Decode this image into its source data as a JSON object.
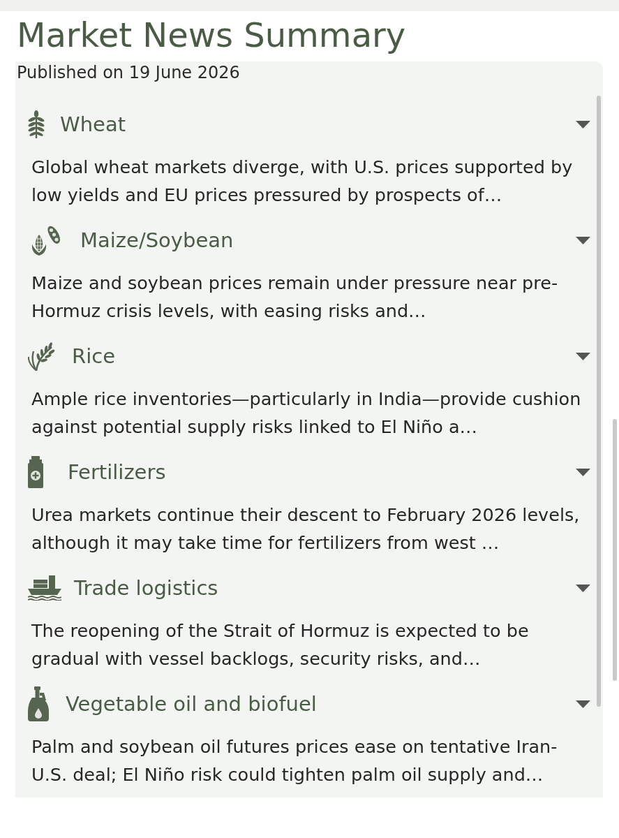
{
  "title": "Market News Summary",
  "published": "Published on 19 June 2026",
  "sections": [
    {
      "kind": "wheat",
      "title": "Wheat",
      "summary": "Global wheat markets diverge, with U.S. prices supported by low yields and EU prices pressured by prospects of…",
      "expanded": false
    },
    {
      "kind": "maize_soybean",
      "title": "Maize/Soybean",
      "summary": "Maize and soybean prices remain under pressure near pre-Hormuz crisis levels, with easing risks and…",
      "expanded": false
    },
    {
      "kind": "rice",
      "title": "Rice",
      "summary": "Ample rice inventories—particularly in India—provide cushion against potential supply risks linked to El Niño a…",
      "expanded": false
    },
    {
      "kind": "fertilizer",
      "title": "Fertilizers",
      "summary": "Urea markets continue their descent to February 2026 levels, although it may take time for fertilizers from west …",
      "expanded": false
    },
    {
      "kind": "logistics",
      "title": "Trade logistics",
      "summary": "The reopening of the Strait of Hormuz is expected to be gradual with vessel backlogs, security risks, and…",
      "expanded": false
    },
    {
      "kind": "veg_oil",
      "title": "Vegetable oil and biofuel",
      "summary": "Palm and soybean oil futures prices ease on tentative Iran-U.S. deal; El Niño risk could tighten palm oil supply and…",
      "expanded": false
    }
  ]
}
